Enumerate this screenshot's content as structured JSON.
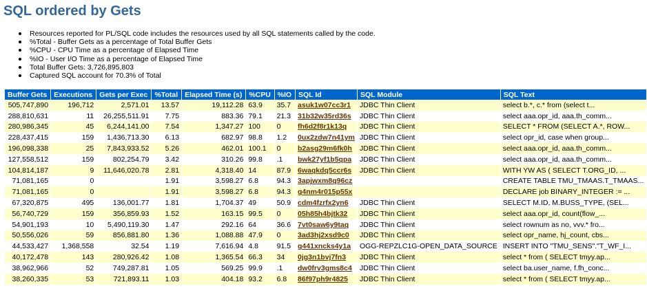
{
  "page": {
    "title": "SQL ordered by Gets",
    "notes": [
      "Resources reported for PL/SQL code includes the resources used by all SQL statements called by the code.",
      "%Total - Buffer Gets as a percentage of Total Buffer Gets",
      "%CPU - CPU Time as a percentage of Elapsed Time",
      "%IO - User I/O Time as a percentage of Elapsed Time",
      "Total Buffer Gets: 3,726,895,803",
      "Captured SQL account for 70.3% of Total"
    ]
  },
  "colors": {
    "title": "#336699",
    "header_bg": "#0066cc",
    "row_odd": "#ffffcc",
    "row_even": "#ffffff",
    "link": "#663300"
  },
  "table": {
    "headers": [
      "Buffer Gets",
      "Executions",
      "Gets per Exec",
      "%Total",
      "Elapsed Time (s)",
      "%CPU",
      "%IO",
      "SQL Id",
      "SQL Module",
      "SQL Text"
    ],
    "rows": [
      [
        "505,747,890",
        "196,712",
        "2,571.01",
        "13.57",
        "19,112.28",
        "63.9",
        "35.7",
        "asuk1w07cc3r1",
        "JDBC Thin Client",
        "select b.*, c.* from (select t..."
      ],
      [
        "288,810,631",
        "11",
        "26,255,511.91",
        "7.75",
        "883.36",
        "79.1",
        "21.3",
        "31b32w35rd36s",
        "JDBC Thin Client",
        "select aaa.opr_id, aaa.th_comm..."
      ],
      [
        "280,986,345",
        "45",
        "6,244,141.00",
        "7.54",
        "1,347.27",
        "100",
        "0",
        "fh6d2f8r1k13q",
        "JDBC Thin Client",
        "SELECT * FROM (SELECT A.*, ROW..."
      ],
      [
        "228,437,415",
        "159",
        "1,436,713.30",
        "6.13",
        "682.97",
        "98.8",
        "1.2",
        "0ux2zdw7n41ym",
        "JDBC Thin Client",
        "select opr_id, case when group..."
      ],
      [
        "196,098,338",
        "25",
        "7,843,933.52",
        "5.26",
        "462.01",
        "100.1",
        "0",
        "b2asg29m6fk0h",
        "JDBC Thin Client",
        "select aaa.opr_id, aaa.th_comm..."
      ],
      [
        "127,558,512",
        "159",
        "802,254.79",
        "3.42",
        "310.26",
        "99.8",
        ".1",
        "bwk27yf1b5qpa",
        "JDBC Thin Client",
        "select aaa.opr_id, aaa.th_comm..."
      ],
      [
        "104,814,187",
        "9",
        "11,646,020.78",
        "2.81",
        "4,318.40",
        "14",
        "87.9",
        "6waqkdq5ccr6s",
        "JDBC Thin Client",
        "WITH YW AS ( SELECT T.ORG_ID, ..."
      ],
      [
        "71,081,165",
        "0",
        "",
        "1.91",
        "3,598.27",
        "6.8",
        "94.3",
        "3apjwxm8q96cz",
        "",
        "CREATE TABLE TMU_TMAAS.T_TMAAS..."
      ],
      [
        "71,081,165",
        "0",
        "",
        "1.91",
        "3,598.27",
        "6.8",
        "94.3",
        "g4nm4r015p55x",
        "",
        "DECLARE job BINARY_INTEGER := ..."
      ],
      [
        "67,320,875",
        "495",
        "136,001.77",
        "1.81",
        "1,704.37",
        "49",
        "50.9",
        "cdm4fzrfx2yn6",
        "JDBC Thin Client",
        "SELECT M.ID, M.BUSS_TYPE, (SEL..."
      ],
      [
        "56,740,729",
        "159",
        "356,859.93",
        "1.52",
        "163.15",
        "99.5",
        "0",
        "05h85h4bjtk32",
        "JDBC Thin Client",
        "select aaa.opr_id, count(flow_..."
      ],
      [
        "54,901,193",
        "10",
        "5,490,119.30",
        "1.47",
        "292.16",
        "64",
        "36.6",
        "7vt0saw6y9taq",
        "JDBC Thin Client",
        "select rownum as no, vvv.* fro..."
      ],
      [
        "50,556,026",
        "59",
        "856,881.80",
        "1.36",
        "1,088.88",
        "47.9",
        "0",
        "3ad3hj2xsd9c0",
        "JDBC Thin Client",
        "select opr_name, hj_count, cbs..."
      ],
      [
        "44,533,427",
        "1,368,558",
        "32.54",
        "1.19",
        "7,616.94",
        "4.8",
        "91.5",
        "g441xncks4y1a",
        "OGG-REPZLC1G-OPEN_DATA_SOURCE",
        "INSERT INTO \"TMU_SENS\".\"T_WF_I..."
      ],
      [
        "40,172,478",
        "143",
        "280,926.42",
        "1.08",
        "1,365.54",
        "66.3",
        "34",
        "0jg3n1bvj7fn3",
        "JDBC Thin Client",
        "select * from ( SELECT tmyy.ap..."
      ],
      [
        "38,962,966",
        "52",
        "749,287.81",
        "1.05",
        "569.25",
        "99.9",
        ".1",
        "dw0frv3gms8c4",
        "JDBC Thin Client",
        "select ba.user_name, f.fh_conc..."
      ],
      [
        "38,260,335",
        "53",
        "721,893.11",
        "1.03",
        "404.18",
        "93.2",
        "6.8",
        "86f97ph9r4825",
        "JDBC Thin Client",
        "select * from ( SELECT tmyy.ap..."
      ]
    ]
  }
}
